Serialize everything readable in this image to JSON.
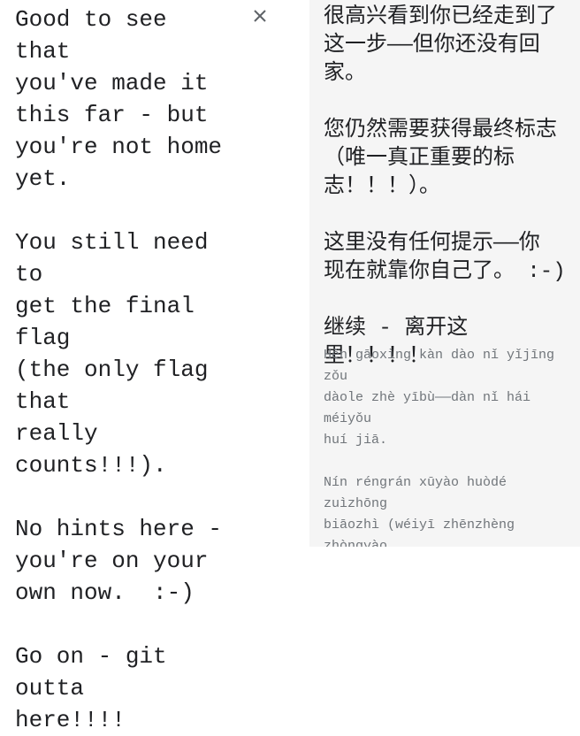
{
  "source": {
    "text": "Good to see that\nyou've made it\nthis far - but\nyou're not home\nyet.\n\nYou still need to\nget the final flag\n(the only flag that\nreally counts!!!).\n\nNo hints here -\nyou're on your\nown now.  :-)\n\nGo on - git outta\nhere!!!!"
  },
  "clear_icon": {
    "glyph": "×",
    "icon": "close-icon"
  },
  "target": {
    "text": "很高兴看到你已经走到了\n这一步——但你还没有回\n家。\n\n您仍然需要获得最终标志\n（唯一真正重要的标\n志！！！）。\n\n这里没有任何提示——你\n现在就靠你自己了。 :-)\n\n继续 - 离开这里！！！！",
    "pinyin": "Hěn gāoxìng kàn dào nǐ yǐjīng zǒu\ndàole zhè yībù——dàn nǐ hái méiyǒu\nhuí jiā.\n\nNín réngrán xūyào huòdé zuìzhōng\nbiāozhì (wéiyī zhēnzhèng zhòngyào\nde biāozhì!!!).\n\nZhèlǐ méiyǒu rènhé tíshì——nǐ xiànzài\njiù kào nǐ zìjǐle. :-)"
  },
  "colors": {
    "target_background": "#f5f5f5",
    "text": "#202124",
    "pinyin": "#70757a",
    "icon": "#5f6368"
  }
}
